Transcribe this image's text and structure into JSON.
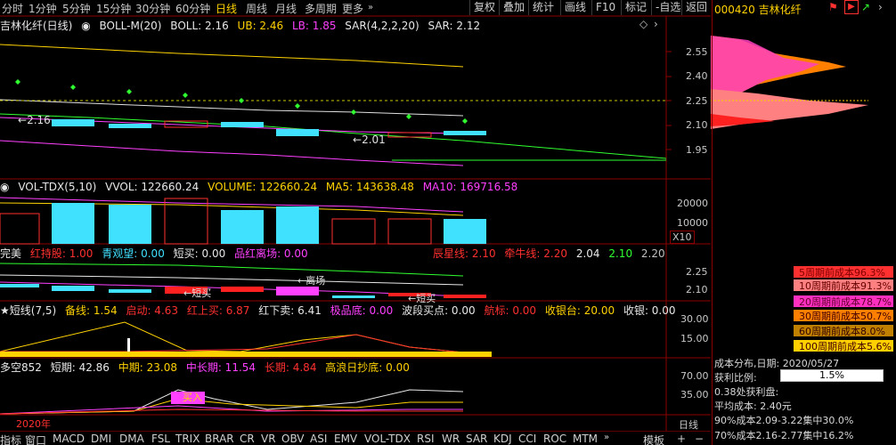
{
  "topbar": {
    "periods": [
      "分时",
      "1分钟",
      "5分钟",
      "15分钟",
      "30分钟",
      "60分钟",
      "日线",
      "周线",
      "月线",
      "多周期",
      "更多"
    ],
    "active": "日线",
    "right_buttons": [
      "复权",
      "叠加",
      "统计",
      "画线",
      "F10",
      "标记",
      "-自选",
      "返回"
    ]
  },
  "main": {
    "stock_label": "吉林化纤(日线)",
    "indicator": "BOLL-M(20)",
    "boll": "BOLL: 2.16",
    "ub": "UB: 2.46",
    "lb": "LB: 1.85",
    "sar": "SAR(4,2,2,20)",
    "sar_val": "SAR: 2.12",
    "annot_high": "2.16",
    "annot_low": "2.01",
    "axis": [
      "2.55",
      "2.40",
      "2.25",
      "2.10",
      "1.95"
    ]
  },
  "vol": {
    "name": "VOL-TDX(5,10)",
    "vvol": "VVOL: 122660.24",
    "volume": "VOLUME: 122660.24",
    "ma5": "MA5: 143638.48",
    "ma10": "MA10: 169716.58",
    "axis": [
      "20000",
      "10000"
    ],
    "unit": "X10"
  },
  "wm": {
    "name": "完美",
    "items": [
      "红持股: 1.00",
      "青观望: 0.00",
      "短买: 0.00",
      "品红离场: 0.00"
    ],
    "right_items": [
      "辰星线: 2.10",
      "牵牛线: 2.20",
      "2.04",
      "2.10",
      "2.20"
    ],
    "label_leave": "←离场",
    "label_buy1": "←短买",
    "label_buy2": "←短买",
    "axis": [
      "2.25",
      "2.10"
    ]
  },
  "dx": {
    "name": "★短线(7,5)",
    "items": [
      "备线: 1.54",
      "启动: 4.63",
      "红上买: 6.87",
      "红下卖: 6.41",
      "极品底: 0.00",
      "波段买点: 0.00",
      "航标: 0.00",
      "收银台: 20.00",
      "收银: 0.00"
    ],
    "axis": [
      "30.00",
      "15.00"
    ]
  },
  "dk": {
    "name": "多空852",
    "items": [
      "短期: 42.86",
      "中期: 23.08",
      "中长期: 11.54",
      "长期: 4.84",
      "高浪日抄底: 0.00"
    ],
    "buy_label": "买入",
    "year": "2020年",
    "axis": [
      "70.00",
      "35.00"
    ],
    "period_label": "日线"
  },
  "right": {
    "title": "000420 吉林化纤",
    "cost_rows": [
      {
        "label": "5周期前成本96.3%",
        "bg": "#ff3030",
        "fg": "#800000"
      },
      {
        "label": "10周期前成本91.3%",
        "bg": "#ff8080",
        "fg": "#600000"
      },
      {
        "label": "20周期前成本78.7%",
        "bg": "#ff30c0",
        "fg": "#600030"
      },
      {
        "label": "30周期前成本50.7%",
        "bg": "#ff8000",
        "fg": "#400000"
      },
      {
        "label": "60周期前成本8.0%",
        "bg": "#c08000",
        "fg": "#300000"
      },
      {
        "label": "100周期前成本5.6%",
        "bg": "#ffd000",
        "fg": "#400000"
      }
    ],
    "dist_date": "成本分布,日期: 2020/05/27",
    "profit_label": "获利比例:",
    "profit_val": "1.5%",
    "profit_line": "0.38处获利盘:",
    "avg_cost": "平均成本: 2.40元",
    "c90": "90%成本2.09-3.22集中30.0%",
    "c70": "70%成本2.16-2.77集中16.2%"
  },
  "bottom": {
    "tabs": [
      "指标",
      "窗口",
      "MACD",
      "DMI",
      "DMA",
      "FSL",
      "TRIX",
      "BRAR",
      "CR",
      "VR",
      "OBV",
      "ASI",
      "EMV",
      "VOL-TDX",
      "RSI",
      "WR",
      "SAR",
      "KDJ",
      "CCI",
      "ROC",
      "MTM"
    ],
    "template": "模板"
  }
}
